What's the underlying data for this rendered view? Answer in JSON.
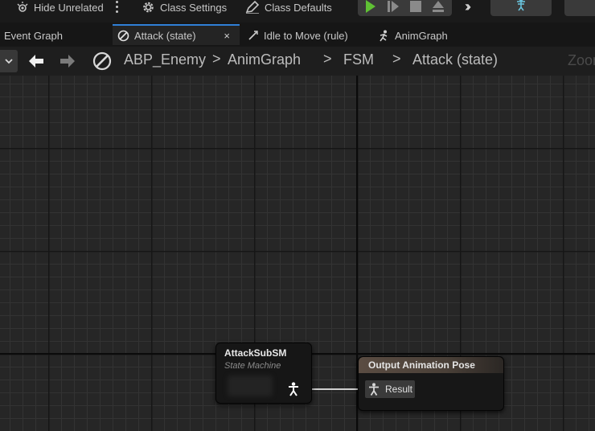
{
  "toolbar": {
    "hide_unrelated": "Hide Unrelated",
    "class_settings": "Class Settings",
    "class_defaults": "Class Defaults",
    "icons": [
      "hide-unrelated-icon",
      "more-options-icon",
      "gear-icon",
      "pencil-icon",
      "play-icon",
      "step-icon",
      "stop-icon",
      "eject-icon",
      "more-tools-icon",
      "skeleton-icon"
    ],
    "play_color": "#5fc134"
  },
  "tabs": [
    {
      "label": "Event Graph",
      "icon": ""
    },
    {
      "label": "Attack (state)",
      "icon": "state-icon",
      "active": true
    },
    {
      "label": "Idle to Move (rule)",
      "icon": "transition-rule-icon"
    },
    {
      "label": "AnimGraph",
      "icon": "animgraph-icon"
    }
  ],
  "tab_close": "×",
  "breadcrumb": {
    "items": [
      "ABP_Enemy",
      "AnimGraph",
      "FSM",
      "Attack (state)"
    ],
    "separator": ">",
    "zoom": "Zoom"
  },
  "graph": {
    "state_machine_node": {
      "title": "AttackSubSM",
      "subtitle": "State Machine"
    },
    "output_pose_node": {
      "title": "Output Animation Pose",
      "pin_label": "Result"
    },
    "header_color": "#5a4c42",
    "accent": "#2f7fd6"
  }
}
